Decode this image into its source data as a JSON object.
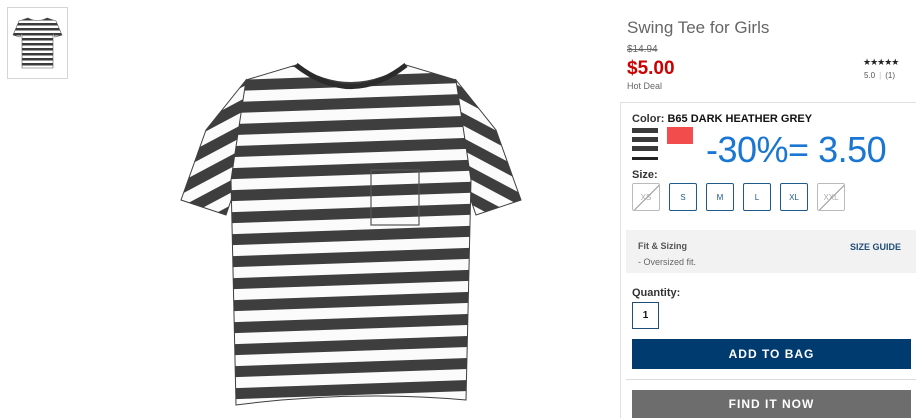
{
  "product": {
    "title": "Swing Tee for Girls",
    "original_price": "$14.94",
    "sale_price": "$5.00",
    "deal_label": "Hot Deal",
    "stars": "★★★★★",
    "rating_value": "5.0",
    "review_count": "(1)"
  },
  "color": {
    "label": "Color:",
    "selected": "B65 DARK HEATHER GREY",
    "swatches": [
      "dark-heather-grey-stripe",
      "coral-red"
    ],
    "swatch_colors": [
      "#3a3a3a",
      "#f24c4c"
    ]
  },
  "promo_overlay": "-30%= 3.50",
  "size": {
    "label": "Size:",
    "options": [
      {
        "label": "XS",
        "available": false
      },
      {
        "label": "S",
        "available": true
      },
      {
        "label": "M",
        "available": true
      },
      {
        "label": "L",
        "available": true
      },
      {
        "label": "XL",
        "available": true
      },
      {
        "label": "XXL",
        "available": false
      }
    ]
  },
  "fit": {
    "title": "Fit & Sizing",
    "description": "- Oversized fit.",
    "size_guide_label": "SIZE GUIDE"
  },
  "quantity": {
    "label": "Quantity:",
    "value": "1"
  },
  "buttons": {
    "add_to_bag": "ADD TO BAG",
    "find_it_now": "FIND IT NOW"
  },
  "colors": {
    "sale_red": "#cc0000",
    "navy": "#003b6f",
    "promo_blue": "#1976d2",
    "find_grey": "#6d6d6d"
  }
}
